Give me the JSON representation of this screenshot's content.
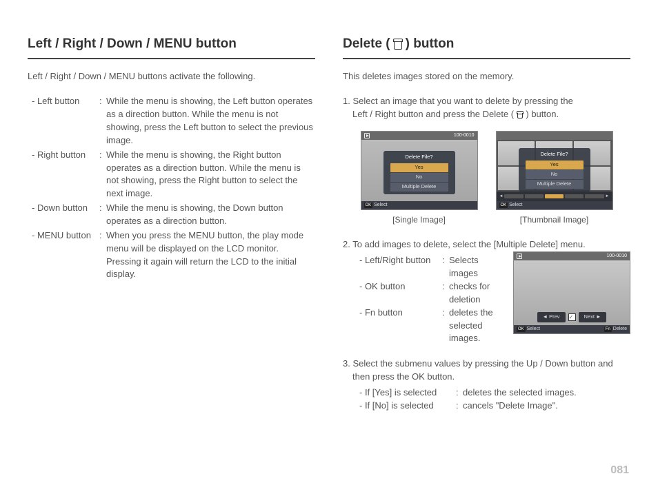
{
  "page_number": "081",
  "left": {
    "heading": "Left / Right / Down / MENU button",
    "intro": "Left / Right / Down / MENU buttons activate the following.",
    "items": [
      {
        "term": "- Left button",
        "desc": "While the menu is showing, the Left button operates as a direction button. While the menu is not showing, press the Left button to select the previous image."
      },
      {
        "term": "- Right button",
        "desc": "While the menu is showing, the Right button operates as a direction button. While the menu is not showing, press the Right button to select the next image."
      },
      {
        "term": "- Down button",
        "desc": "While the menu is showing, the Down button operates as a direction button."
      },
      {
        "term": "- MENU button",
        "desc": "When you press the MENU button, the play mode menu will be displayed on the LCD monitor. Pressing it again will return the LCD to the initial display."
      }
    ]
  },
  "right": {
    "heading_prefix": "Delete (",
    "heading_suffix": ") button",
    "intro": "This deletes images stored on the memory.",
    "step1_line1": "1. Select an image that you want to delete by pressing the",
    "step1_line2_prefix": "Left / Right button and press the Delete (",
    "step1_line2_suffix": ") button.",
    "dialog_title": "Delete File?",
    "dialog_yes": "Yes",
    "dialog_no": "No",
    "dialog_multi": "Multiple Delete",
    "ok_label": "OK",
    "select_label": "Select",
    "img_counter": "100-0010",
    "caption_single": "[Single Image]",
    "caption_thumb": "[Thumbnail Image]",
    "step2_intro": "2. To add images to delete, select the [Multiple Delete] menu.",
    "step2_items": [
      {
        "term": "- Left/Right button",
        "desc": "Selects images"
      },
      {
        "term": "- OK button",
        "desc": "checks for deletion"
      },
      {
        "term": "- Fn button",
        "desc": "deletes the selected images."
      }
    ],
    "prev_label": "Prev",
    "next_label": "Next",
    "fn_label": "Fn",
    "delete_label": "Delete",
    "step3_line1": "3. Select the submenu values by pressing the Up / Down button and then press the OK button.",
    "step3_items": [
      {
        "term": "- If [Yes] is selected",
        "desc": "deletes the selected images."
      },
      {
        "term": "- If [No] is selected",
        "desc": "cancels \"Delete Image\"."
      }
    ]
  }
}
